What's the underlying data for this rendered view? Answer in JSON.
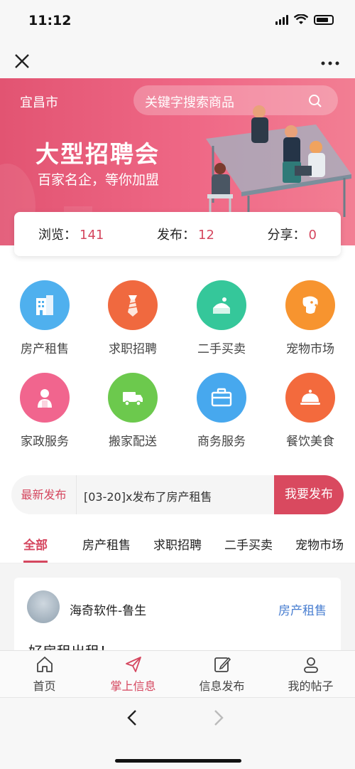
{
  "status": {
    "time": "11:12"
  },
  "banner": {
    "city": "宜昌市",
    "search_placeholder": "关键字搜索商品",
    "title": "大型招聘会",
    "subtitle": "百家名企，等你加盟"
  },
  "stats": [
    {
      "label": "浏览：",
      "value": "141"
    },
    {
      "label": "发布：",
      "value": "12"
    },
    {
      "label": "分享：",
      "value": "0"
    }
  ],
  "categories": [
    {
      "label": "房产租售",
      "color": "#4fb0ee"
    },
    {
      "label": "求职招聘",
      "color": "#f0693f"
    },
    {
      "label": "二手买卖",
      "color": "#35c79a"
    },
    {
      "label": "宠物市场",
      "color": "#f7942f"
    },
    {
      "label": "家政服务",
      "color": "#f1658e"
    },
    {
      "label": "搬家配送",
      "color": "#6cc94d"
    },
    {
      "label": "商务服务",
      "color": "#47a8ee"
    },
    {
      "label": "餐饮美食",
      "color": "#f36a3d"
    }
  ],
  "news": {
    "tag": "最新发布",
    "text": "[03-20]x发布了房产租售",
    "button": "我要发布"
  },
  "tabs": [
    "全部",
    "房产租售",
    "求职招聘",
    "二手买卖",
    "宠物市场"
  ],
  "post": {
    "user": "海奇软件-鲁生",
    "category": "房产租售",
    "title": "好房租出租！"
  },
  "tabbar": [
    {
      "label": "首页",
      "icon": "home-icon"
    },
    {
      "label": "掌上信息",
      "icon": "send-icon"
    },
    {
      "label": "信息发布",
      "icon": "edit-icon"
    },
    {
      "label": "我的帖子",
      "icon": "user-icon"
    }
  ],
  "browser": {
    "back": "‹",
    "forward": "›"
  },
  "colors": {
    "accent": "#d5475f",
    "banner": "#ef6886",
    "link": "#4a7fd1"
  }
}
